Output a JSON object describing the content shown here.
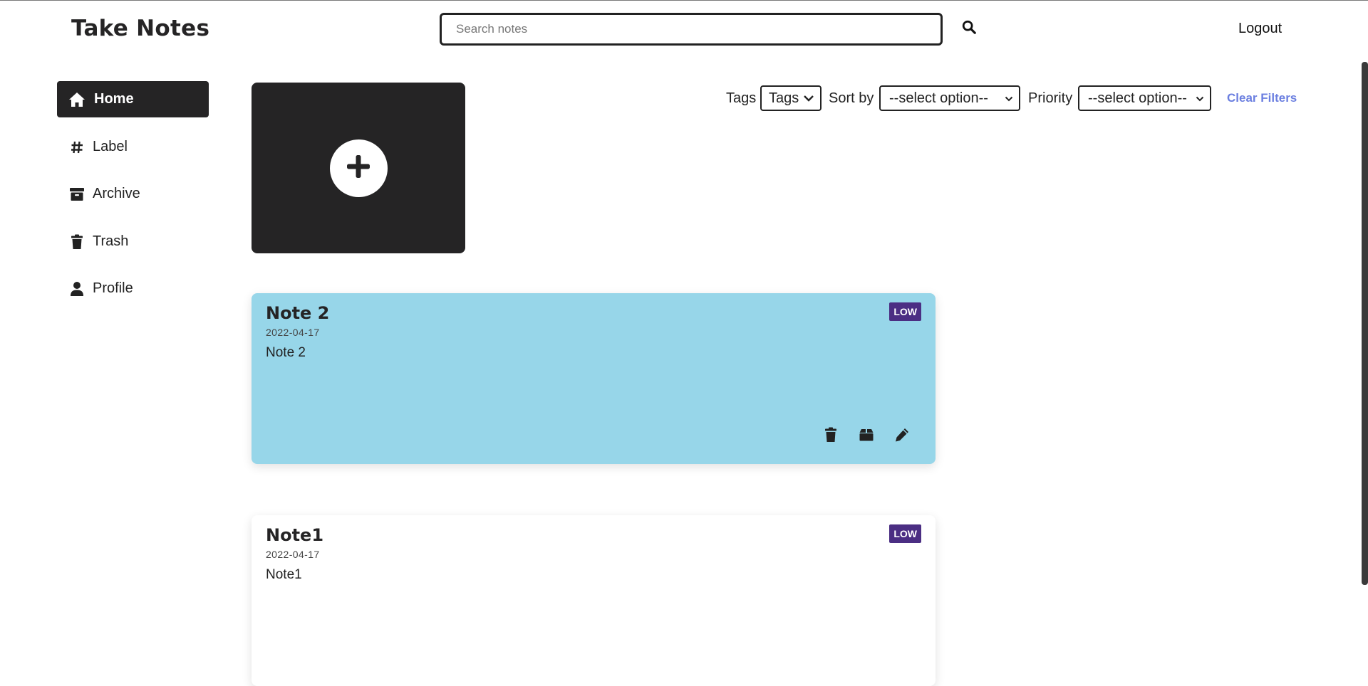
{
  "header": {
    "brand": "Take Notes",
    "search_placeholder": "Search notes",
    "search_icon": "search-icon",
    "logout_label": "Logout"
  },
  "sidebar": {
    "items": [
      {
        "label": "Home",
        "icon": "home-icon",
        "active": true
      },
      {
        "label": "Label",
        "icon": "hash-icon",
        "active": false
      },
      {
        "label": "Archive",
        "icon": "archive-icon",
        "active": false
      },
      {
        "label": "Trash",
        "icon": "trash-icon",
        "active": false
      },
      {
        "label": "Profile",
        "icon": "user-icon",
        "active": false
      }
    ]
  },
  "add_note": {
    "icon": "plus-icon"
  },
  "filters": {
    "tags_label": "Tags",
    "tags_value": "Tags",
    "sort_label": "Sort by",
    "sort_value": "--select option--",
    "priority_label": "Priority",
    "priority_value": "--select option--",
    "clear_label": "Clear Filters"
  },
  "notes": [
    {
      "title": "Note 2",
      "date": "2022-04-17",
      "body": "Note 2",
      "priority": "LOW",
      "color": "#97d6e9"
    },
    {
      "title": "Note1",
      "date": "2022-04-17",
      "body": "Note1",
      "priority": "LOW",
      "color": "#ffffff"
    }
  ],
  "colors": {
    "dark": "#252425",
    "accent_link": "#6b7fe0",
    "badge": "#4b2e83"
  }
}
